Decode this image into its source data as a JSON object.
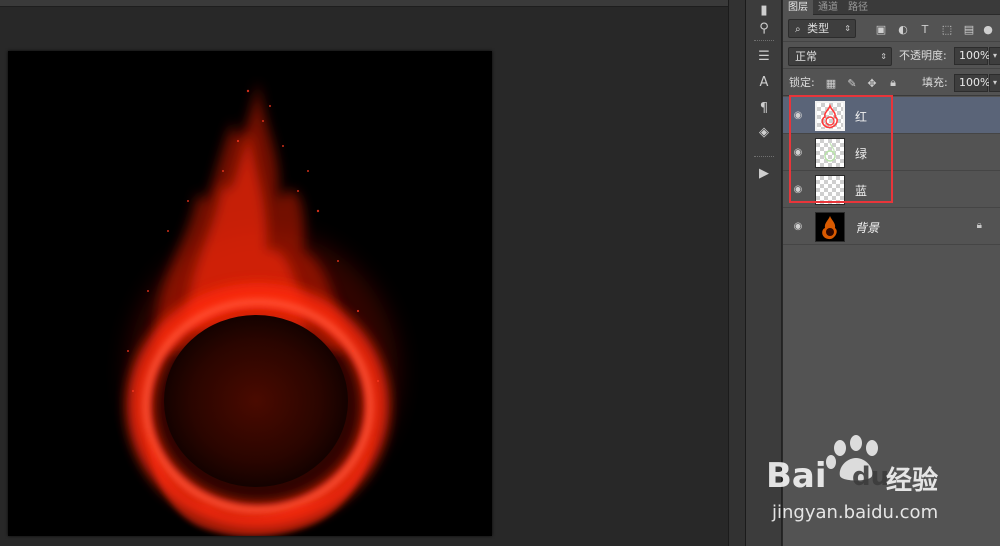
{
  "panel": {
    "tabs": [
      "图层",
      "通道",
      "路径"
    ],
    "filter": {
      "label": "类型",
      "search_icon": "search-icon"
    },
    "blend_mode": "正常",
    "opacity_label": "不透明度:",
    "opacity_value": "100%",
    "lock_label": "锁定:",
    "fill_label": "填充:",
    "fill_value": "100%"
  },
  "layers": [
    {
      "name": "红",
      "selected": true,
      "visible": true,
      "thumb": "red-flame"
    },
    {
      "name": "绿",
      "selected": false,
      "visible": true,
      "thumb": "green-transparent"
    },
    {
      "name": "蓝",
      "selected": false,
      "visible": true,
      "thumb": "transparent"
    },
    {
      "name": "背景",
      "selected": false,
      "visible": true,
      "thumb": "fire",
      "locked": true
    }
  ],
  "colors": {
    "selection_box": "#e8353a",
    "selected_row": "#5a6478",
    "panel_bg": "#535353",
    "workspace_bg": "#282828"
  },
  "watermark": {
    "logo_text": "Bai",
    "logo_text2": "du",
    "brand_cn": "经验",
    "url": "jingyan.baidu.com"
  }
}
